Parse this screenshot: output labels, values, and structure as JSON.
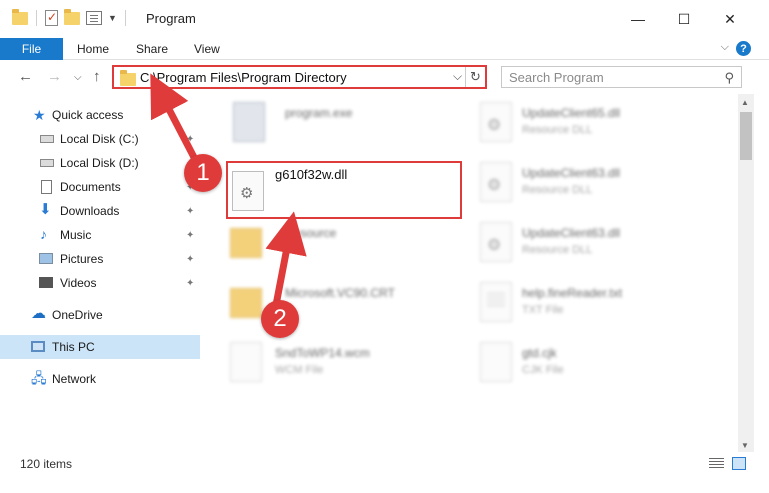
{
  "window": {
    "title": "Program",
    "minimize_glyph": "—",
    "maximize_glyph": "☐",
    "close_glyph": "✕"
  },
  "ribbon": {
    "file_tab": "File",
    "tabs": [
      "Home",
      "Share",
      "View"
    ],
    "help_glyph": "?"
  },
  "address": {
    "path": "C:\\Program Files\\Program Directory",
    "search_placeholder": "Search Program"
  },
  "sidebar": {
    "items": [
      {
        "label": "Quick access",
        "icon": "star-icon",
        "pinned": false
      },
      {
        "label": "Local Disk (C:)",
        "icon": "drive-icon",
        "pinned": true
      },
      {
        "label": "Local Disk (D:)",
        "icon": "drive-icon",
        "pinned": true
      },
      {
        "label": "Documents",
        "icon": "documents-icon",
        "pinned": true
      },
      {
        "label": "Downloads",
        "icon": "downloads-icon",
        "pinned": true
      },
      {
        "label": "Music",
        "icon": "music-icon",
        "pinned": true
      },
      {
        "label": "Pictures",
        "icon": "pictures-icon",
        "pinned": true
      },
      {
        "label": "Videos",
        "icon": "videos-icon",
        "pinned": true
      },
      {
        "label": "OneDrive",
        "icon": "cloud-icon",
        "pinned": false
      },
      {
        "label": "This PC",
        "icon": "computer-icon",
        "pinned": false,
        "selected": true
      },
      {
        "label": "Network",
        "icon": "network-icon",
        "pinned": false
      }
    ]
  },
  "files": [
    {
      "name": "program.exe",
      "type": "",
      "icon": "exe-icon"
    },
    {
      "name": "UpdateClient65.dll",
      "type": "Resource DLL",
      "icon": "dll-icon"
    },
    {
      "name": "UpdateClient63.dll",
      "type": "Resource DLL",
      "icon": "dll-icon"
    },
    {
      "name": "Resource",
      "type": "",
      "icon": "folder-icon"
    },
    {
      "name": "UpdateClient63.dll",
      "type": "Resource DLL",
      "icon": "dll-icon"
    },
    {
      "name": "Microsoft.VC90.CRT",
      "type": "",
      "icon": "folder-icon"
    },
    {
      "name": "help.fineReader.txt",
      "type": "TXT File",
      "icon": "txt-icon"
    },
    {
      "name": "SndToWP14.wcm",
      "type": "WCM File",
      "icon": "file-icon"
    },
    {
      "name": "gtd.cjk",
      "type": "CJK File",
      "icon": "file-icon"
    }
  ],
  "selected_file": {
    "name": "g610f32w.dll",
    "icon": "dll-icon"
  },
  "status": {
    "item_count": "120 items"
  },
  "annotations": {
    "step1": "1",
    "step2": "2"
  },
  "colors": {
    "accent": "#1979ca",
    "highlight": "#e03b3b",
    "selection": "#cce4f7"
  }
}
